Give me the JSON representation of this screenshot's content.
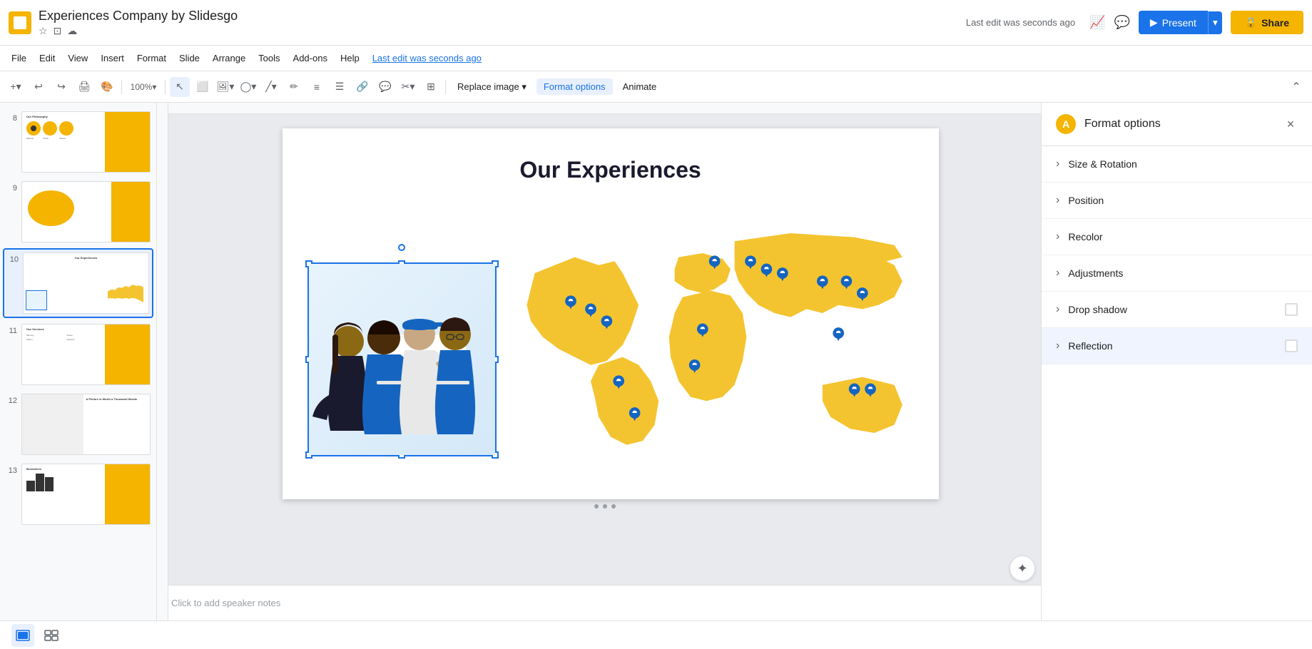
{
  "app": {
    "icon_label": "A",
    "title": "Experiences Company by Slidesgo",
    "last_edit": "Last edit was seconds ago"
  },
  "menu": {
    "items": [
      "File",
      "Edit",
      "View",
      "Insert",
      "Format",
      "Slide",
      "Arrange",
      "Tools",
      "Add-ons",
      "Help"
    ]
  },
  "toolbar": {
    "replace_image_label": "Replace image",
    "format_options_label": "Format options",
    "animate_label": "Animate"
  },
  "format_panel": {
    "title": "Format options",
    "close_label": "×",
    "icon_label": "A",
    "options": [
      {
        "label": "Size & Rotation",
        "checked": false
      },
      {
        "label": "Position",
        "checked": false
      },
      {
        "label": "Recolor",
        "checked": false
      },
      {
        "label": "Adjustments",
        "checked": false
      },
      {
        "label": "Drop shadow",
        "checked": false
      },
      {
        "label": "Reflection",
        "checked": false
      }
    ]
  },
  "slide_canvas": {
    "title": "Our Experiences",
    "notes_placeholder": "Click to add speaker notes"
  },
  "slides": [
    {
      "num": "8",
      "has_yellow": true
    },
    {
      "num": "9",
      "has_yellow": true
    },
    {
      "num": "10",
      "has_yellow": true,
      "active": true
    },
    {
      "num": "11",
      "has_yellow": true
    },
    {
      "num": "12",
      "has_yellow": false
    },
    {
      "num": "13",
      "has_yellow": true
    }
  ],
  "bottom_bar": {
    "slide_view_label": "Slide view",
    "grid_view_label": "Grid view"
  },
  "colors": {
    "yellow": "#f4b400",
    "blue": "#1a73e8",
    "dark": "#202124",
    "light_gray": "#f8f9fa",
    "border": "#e0e0e0",
    "map_yellow": "#f4c430",
    "pin_blue": "#1565c0"
  }
}
